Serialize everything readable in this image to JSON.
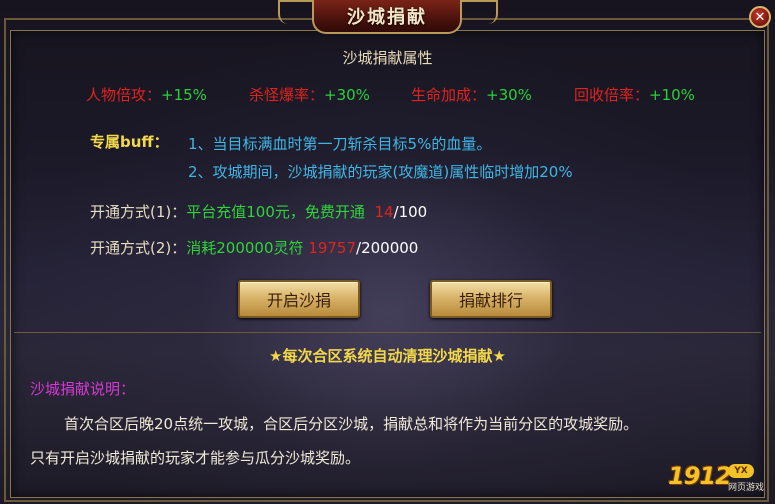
{
  "window": {
    "title": "沙城捐献",
    "close_symbol": "✕"
  },
  "section_title": "沙城捐献属性",
  "stats": [
    {
      "label": "人物倍攻：",
      "value": "+15%"
    },
    {
      "label": "杀怪爆率：",
      "value": "+30%"
    },
    {
      "label": "生命加成：",
      "value": "+30%"
    },
    {
      "label": "回收倍率：",
      "value": "+10%"
    }
  ],
  "buff": {
    "label": "专属buff：",
    "lines": [
      "1、当目标满血时第一刀斩杀目标5%的血量。",
      "2、攻城期间，沙城捐献的玩家(攻魔道)属性临时增加20%"
    ]
  },
  "open_methods": [
    {
      "label": "开通方式(1)：",
      "desc": "平台充值100元，免费开通",
      "current": "14",
      "total": "/100"
    },
    {
      "label": "开通方式(2)：",
      "desc": "消耗200000灵符",
      "current": "19757",
      "total": "/200000"
    }
  ],
  "buttons": {
    "open": "开启沙捐",
    "ranking": "捐献排行"
  },
  "notice": "★每次合区系统自动清理沙城捐献★",
  "description": {
    "label": "沙城捐献说明：",
    "lines": [
      "首次合区后晚20点统一攻城，合区后分区沙城，捐献总和将作为当前分区的攻城奖励。",
      "只有开启沙城捐献的玩家才能参与瓜分沙城奖励。"
    ]
  },
  "logo": {
    "number": "1912",
    "badge": "YX",
    "sub": "网页游戏"
  }
}
